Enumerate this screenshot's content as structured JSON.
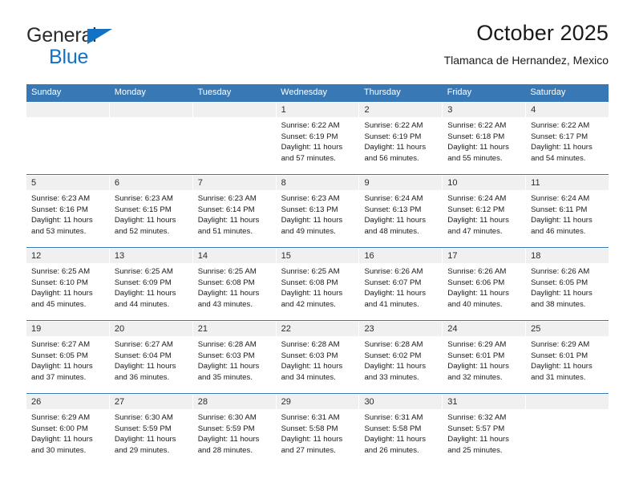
{
  "brand": {
    "line1": "General",
    "line2": "Blue",
    "triangle_icon": "triangle-icon",
    "colors": {
      "blue": "#1273c4",
      "dark": "#2b2b2b"
    }
  },
  "header": {
    "title": "October 2025",
    "subtitle": "Tlamanca de Hernandez, Mexico"
  },
  "calendar": {
    "header_bg": "#3878b4",
    "day_strip_bg": "#f0f0f0",
    "weekdays": [
      "Sunday",
      "Monday",
      "Tuesday",
      "Wednesday",
      "Thursday",
      "Friday",
      "Saturday"
    ],
    "weeks": [
      [
        {
          "day": "",
          "empty": true
        },
        {
          "day": "",
          "empty": true
        },
        {
          "day": "",
          "empty": true
        },
        {
          "day": "1",
          "sunrise": "Sunrise: 6:22 AM",
          "sunset": "Sunset: 6:19 PM",
          "daylight": "Daylight: 11 hours and 57 minutes."
        },
        {
          "day": "2",
          "sunrise": "Sunrise: 6:22 AM",
          "sunset": "Sunset: 6:19 PM",
          "daylight": "Daylight: 11 hours and 56 minutes."
        },
        {
          "day": "3",
          "sunrise": "Sunrise: 6:22 AM",
          "sunset": "Sunset: 6:18 PM",
          "daylight": "Daylight: 11 hours and 55 minutes."
        },
        {
          "day": "4",
          "sunrise": "Sunrise: 6:22 AM",
          "sunset": "Sunset: 6:17 PM",
          "daylight": "Daylight: 11 hours and 54 minutes."
        }
      ],
      [
        {
          "day": "5",
          "sunrise": "Sunrise: 6:23 AM",
          "sunset": "Sunset: 6:16 PM",
          "daylight": "Daylight: 11 hours and 53 minutes."
        },
        {
          "day": "6",
          "sunrise": "Sunrise: 6:23 AM",
          "sunset": "Sunset: 6:15 PM",
          "daylight": "Daylight: 11 hours and 52 minutes."
        },
        {
          "day": "7",
          "sunrise": "Sunrise: 6:23 AM",
          "sunset": "Sunset: 6:14 PM",
          "daylight": "Daylight: 11 hours and 51 minutes."
        },
        {
          "day": "8",
          "sunrise": "Sunrise: 6:23 AM",
          "sunset": "Sunset: 6:13 PM",
          "daylight": "Daylight: 11 hours and 49 minutes."
        },
        {
          "day": "9",
          "sunrise": "Sunrise: 6:24 AM",
          "sunset": "Sunset: 6:13 PM",
          "daylight": "Daylight: 11 hours and 48 minutes."
        },
        {
          "day": "10",
          "sunrise": "Sunrise: 6:24 AM",
          "sunset": "Sunset: 6:12 PM",
          "daylight": "Daylight: 11 hours and 47 minutes."
        },
        {
          "day": "11",
          "sunrise": "Sunrise: 6:24 AM",
          "sunset": "Sunset: 6:11 PM",
          "daylight": "Daylight: 11 hours and 46 minutes."
        }
      ],
      [
        {
          "day": "12",
          "sunrise": "Sunrise: 6:25 AM",
          "sunset": "Sunset: 6:10 PM",
          "daylight": "Daylight: 11 hours and 45 minutes."
        },
        {
          "day": "13",
          "sunrise": "Sunrise: 6:25 AM",
          "sunset": "Sunset: 6:09 PM",
          "daylight": "Daylight: 11 hours and 44 minutes."
        },
        {
          "day": "14",
          "sunrise": "Sunrise: 6:25 AM",
          "sunset": "Sunset: 6:08 PM",
          "daylight": "Daylight: 11 hours and 43 minutes."
        },
        {
          "day": "15",
          "sunrise": "Sunrise: 6:25 AM",
          "sunset": "Sunset: 6:08 PM",
          "daylight": "Daylight: 11 hours and 42 minutes."
        },
        {
          "day": "16",
          "sunrise": "Sunrise: 6:26 AM",
          "sunset": "Sunset: 6:07 PM",
          "daylight": "Daylight: 11 hours and 41 minutes."
        },
        {
          "day": "17",
          "sunrise": "Sunrise: 6:26 AM",
          "sunset": "Sunset: 6:06 PM",
          "daylight": "Daylight: 11 hours and 40 minutes."
        },
        {
          "day": "18",
          "sunrise": "Sunrise: 6:26 AM",
          "sunset": "Sunset: 6:05 PM",
          "daylight": "Daylight: 11 hours and 38 minutes."
        }
      ],
      [
        {
          "day": "19",
          "sunrise": "Sunrise: 6:27 AM",
          "sunset": "Sunset: 6:05 PM",
          "daylight": "Daylight: 11 hours and 37 minutes."
        },
        {
          "day": "20",
          "sunrise": "Sunrise: 6:27 AM",
          "sunset": "Sunset: 6:04 PM",
          "daylight": "Daylight: 11 hours and 36 minutes."
        },
        {
          "day": "21",
          "sunrise": "Sunrise: 6:28 AM",
          "sunset": "Sunset: 6:03 PM",
          "daylight": "Daylight: 11 hours and 35 minutes."
        },
        {
          "day": "22",
          "sunrise": "Sunrise: 6:28 AM",
          "sunset": "Sunset: 6:03 PM",
          "daylight": "Daylight: 11 hours and 34 minutes."
        },
        {
          "day": "23",
          "sunrise": "Sunrise: 6:28 AM",
          "sunset": "Sunset: 6:02 PM",
          "daylight": "Daylight: 11 hours and 33 minutes."
        },
        {
          "day": "24",
          "sunrise": "Sunrise: 6:29 AM",
          "sunset": "Sunset: 6:01 PM",
          "daylight": "Daylight: 11 hours and 32 minutes."
        },
        {
          "day": "25",
          "sunrise": "Sunrise: 6:29 AM",
          "sunset": "Sunset: 6:01 PM",
          "daylight": "Daylight: 11 hours and 31 minutes."
        }
      ],
      [
        {
          "day": "26",
          "sunrise": "Sunrise: 6:29 AM",
          "sunset": "Sunset: 6:00 PM",
          "daylight": "Daylight: 11 hours and 30 minutes."
        },
        {
          "day": "27",
          "sunrise": "Sunrise: 6:30 AM",
          "sunset": "Sunset: 5:59 PM",
          "daylight": "Daylight: 11 hours and 29 minutes."
        },
        {
          "day": "28",
          "sunrise": "Sunrise: 6:30 AM",
          "sunset": "Sunset: 5:59 PM",
          "daylight": "Daylight: 11 hours and 28 minutes."
        },
        {
          "day": "29",
          "sunrise": "Sunrise: 6:31 AM",
          "sunset": "Sunset: 5:58 PM",
          "daylight": "Daylight: 11 hours and 27 minutes."
        },
        {
          "day": "30",
          "sunrise": "Sunrise: 6:31 AM",
          "sunset": "Sunset: 5:58 PM",
          "daylight": "Daylight: 11 hours and 26 minutes."
        },
        {
          "day": "31",
          "sunrise": "Sunrise: 6:32 AM",
          "sunset": "Sunset: 5:57 PM",
          "daylight": "Daylight: 11 hours and 25 minutes."
        },
        {
          "day": "",
          "empty": true
        }
      ]
    ]
  }
}
